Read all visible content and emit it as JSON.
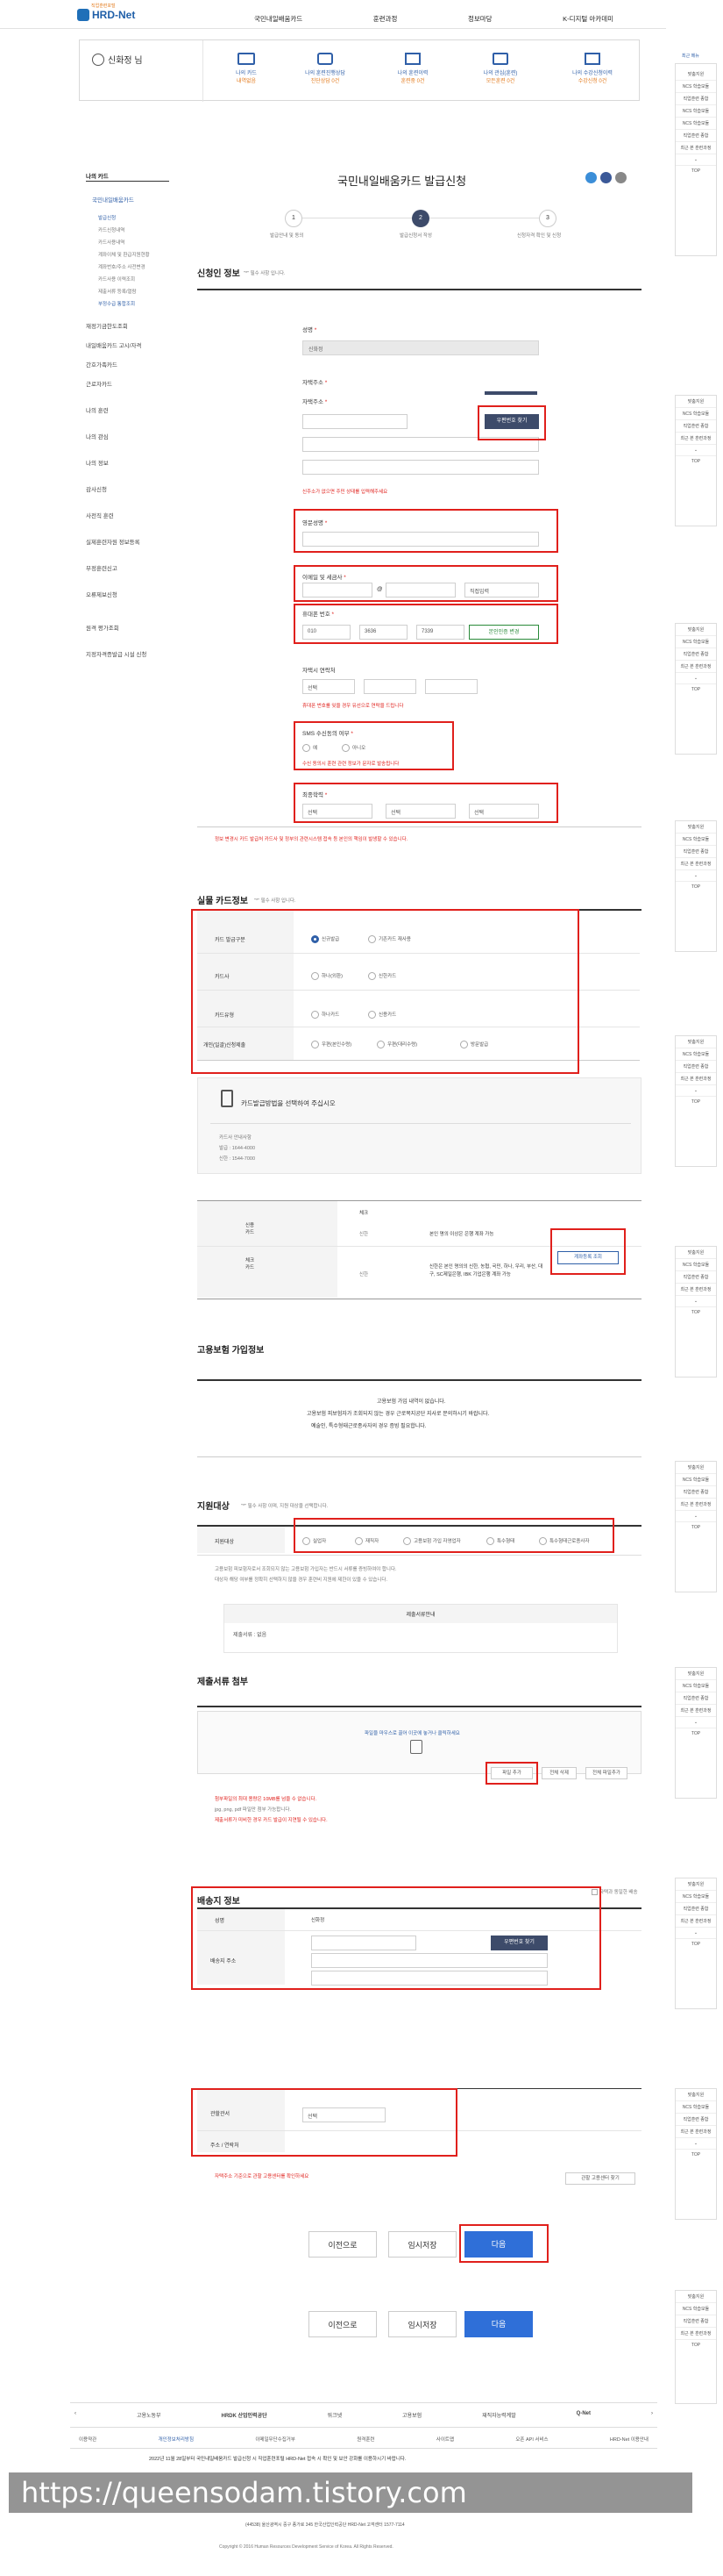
{
  "header": {
    "logo_sub": "직업훈련포털",
    "logo": "HRD-Net",
    "nav": [
      "국민내일배움카드",
      "훈련과정",
      "정보마당",
      "K-디지털 아카데미"
    ]
  },
  "userbox": {
    "name": "신화정 님",
    "items": [
      {
        "title": "나의 카드",
        "sub": "내역없음"
      },
      {
        "title": "나의 훈련진행상담",
        "sub": "진단상담 0건"
      },
      {
        "title": "나의 훈련이력",
        "sub": "훈련중 0건"
      },
      {
        "title": "나의 관심(훈련)",
        "sub": "모든훈련 0건"
      },
      {
        "title": "나의 수강신청이력",
        "sub": "수강신청 0건"
      }
    ]
  },
  "sidebar": {
    "title": "나의 카드",
    "active": "국민내일배움카드",
    "subs": [
      "발급신청",
      "카드신청내역",
      "카드사용내역",
      "계좌이체 및 환급지원현황",
      "계좌번호/주소 사전변경",
      "카드사용 이력조회",
      "제출서류 등록/열람",
      "부정수급 통합조회"
    ],
    "items": [
      "재정기금한도조회",
      "내일배움카드 고시/자격",
      "간호가족카드",
      "근로자카드",
      "나의 훈련",
      "나의 관심",
      "나의 정보",
      "감사신청",
      "사전직 훈련",
      "실제훈련자원 정보등록",
      "부정훈련신고",
      "오류제보신청",
      "원격 평가조회",
      "지정자격증발급 시설 신청"
    ]
  },
  "page": {
    "title": "국민내일배움카드 발급신청",
    "steps": [
      {
        "num": "1",
        "label": "발급안내 및 동의"
      },
      {
        "num": "2",
        "label": "발급신청서 작성"
      },
      {
        "num": "3",
        "label": "신청자격 확인 및 신청"
      }
    ]
  },
  "applicant": {
    "section_title": "신청인 정보",
    "required_note": "\"*\" 필수 사항 입니다.",
    "name_label": "성명",
    "name_value": "신화정",
    "address_label": "자택주소",
    "zip_button": "우편번호 찾기",
    "address_note": "신주소가 없으면 주민 상태를 입력해주세요",
    "eng_name_label": "영문성명",
    "email_label": "이메일 및 세금사",
    "email_at": "@",
    "email_domain": "직접입력",
    "phone_label": "휴대폰 번호",
    "phone_parts": [
      "010",
      "3636",
      "7339"
    ],
    "phone_button": "본인인증 변경",
    "home_phone_label": "자택시 연락처",
    "home_phone_sel": "선택",
    "home_phone_note": "휴대폰 번호를 잊을 경우 유선으로 연락을 드립니다",
    "sms_label": "SMS 수신동의 여부",
    "sms_yes": "예",
    "sms_no": "아니오",
    "sms_note": "수신 동의시 훈련 관련 정보가 문자로 발송됩니다",
    "edu_label": "최종학력",
    "edu_sels": [
      "선택",
      "선택",
      "선택"
    ],
    "footer_note": "정보 변경시 카드 발급처 카드사 및 정부의 관련시스템 접속 등 본인의 책임이 발생할 수 있습니다."
  },
  "card": {
    "section_title": "실물 카드정보",
    "required_note": "\"*\" 필수 사항 입니다.",
    "rows": [
      {
        "label": "카드 발급구분",
        "options": [
          "신규발급",
          "기존카드 재사용"
        ]
      },
      {
        "label": "카드사",
        "options": [
          "하나(외환)",
          "신한카드"
        ]
      },
      {
        "label": "카드유형",
        "options": [
          "하나카드",
          "신용카드"
        ]
      },
      {
        "label": "개인(일괄)신청제출",
        "options": [
          "우편(본인수령)",
          "우편(대리수령)",
          "방문발급"
        ]
      }
    ],
    "notice_title": "카드발급방법을 선택하여 주십시오",
    "notice_lines": [
      "카드사 안내사항",
      "발급 : 1644-4000",
      "신한 : 1544-7000"
    ],
    "table_hdr": "체크",
    "table_row1_label": "신용\n카드",
    "table_row1_sub": "신한",
    "table_row1_text": "본인 명의 이상은 은행 계좌 가능",
    "table_row2_label": "체크\n카드",
    "table_row2_sub": "신한",
    "table_row2_text": "신한은 본인 명의의 신한, 농협, 국민, 하나, 우리, 부산, 대구, SC제일은행, IBK 기업은행 계좌 가능",
    "table_button": "계좌등록 조회"
  },
  "insurance": {
    "section_title": "고용보험 가입정보",
    "lines": [
      "고용보험 가입 내역이 없습니다.",
      "고용보험 피보험자가 조회되지 않는 경우 근로복지공단 지사로 문의하시기 바랍니다.",
      "예술인, 특수형태근로종사자의 경우 증빙 필요합니다."
    ]
  },
  "support": {
    "section_title": "지원대상",
    "required_note": "\"*\" 필수 사항 이며, 지원 대상을 선택합니다.",
    "row_label": "지원대상",
    "options": [
      "실업자",
      "재직자",
      "고용보험 가입 자영업자",
      "특수형태",
      "특수형태근로종사자"
    ],
    "desc": [
      "고용보험 피보험자로서 조회되지 않는 고용보험 가입자는 반드시 서류를 증빙하여야 합니다.",
      "대상자 해당 여부를 정확히 선택하지 않을 경우 훈련비 지원에 제한이 있을 수 있습니다."
    ],
    "doc_title": "제출서류안내",
    "doc_item": "제출서류 : 없음"
  },
  "upload": {
    "section_title": "제출서류 첨부",
    "drop_text": "파일을 마우스로 끌어 이곳에 놓거나 클릭하세요",
    "buttons": [
      "파일 추가",
      "전체 삭제",
      "전체 파일추가"
    ],
    "notes": [
      "첨부파일의 최대 용량은 10MB를 넘을 수 없습니다.",
      "jpg, png, pdf 파일만 첨부 가능합니다.",
      "제출서류가 미비한 경우 카드 발급이 지연될 수 있습니다."
    ]
  },
  "delivery": {
    "section_title": "배송지 정보",
    "same_check": "자택과 동일한 배송",
    "name_label": "성명",
    "name_value": "신화정",
    "addr_label": "배송지 주소",
    "zip_button": "우편번호 찾기",
    "office_label": "관할관서",
    "office_sel": "선택",
    "office_addr_label": "주소 / 연락처",
    "office_note": "자택주소 기준으로 관할 고용센터를 확인하세요",
    "office_button": "관할 고용센터 찾기"
  },
  "actions": {
    "prev": "이전으로",
    "save": "임시저장",
    "next": "다음"
  },
  "right_panel": {
    "title": "최근 메뉴",
    "items": [
      "맞춤지원",
      "NCS 학습모듈",
      "직업훈련 종합",
      "최근 본 훈련과정"
    ],
    "top": "TOP"
  },
  "footer": {
    "partners": [
      "고용노동부",
      "HRDK 산업인력공단",
      "워크넷",
      "고용보험",
      "재직자능력계발",
      "Q-Net"
    ],
    "links": [
      "이용약관",
      "개인정보처리방침",
      "이메일무단수집거부",
      "원격훈련",
      "사이트맵",
      "오픈 API 서비스",
      "HRD-Net 이용안내"
    ],
    "notice": "2022년 11월 28일부터 국민내일배움카드 발급신청 시 직업훈련포털 HRD-Net 접속 시 확인 및 보안 강화를 이용하시기 바랍니다.",
    "address": "(44538) 울산광역시 중구 종가로 345 한국산업인력공단 HRD-Net 고객센터 1577-7114",
    "copyright": "Copyright © 2016 Human Resources Development Service of Korea. All Rights Reserved.",
    "watermark": "https://queensodam.tistory.com"
  },
  "colors": {
    "accent": "#e0201c",
    "primary": "#2f5fa8",
    "dark_btn": "#3d4b6a"
  }
}
